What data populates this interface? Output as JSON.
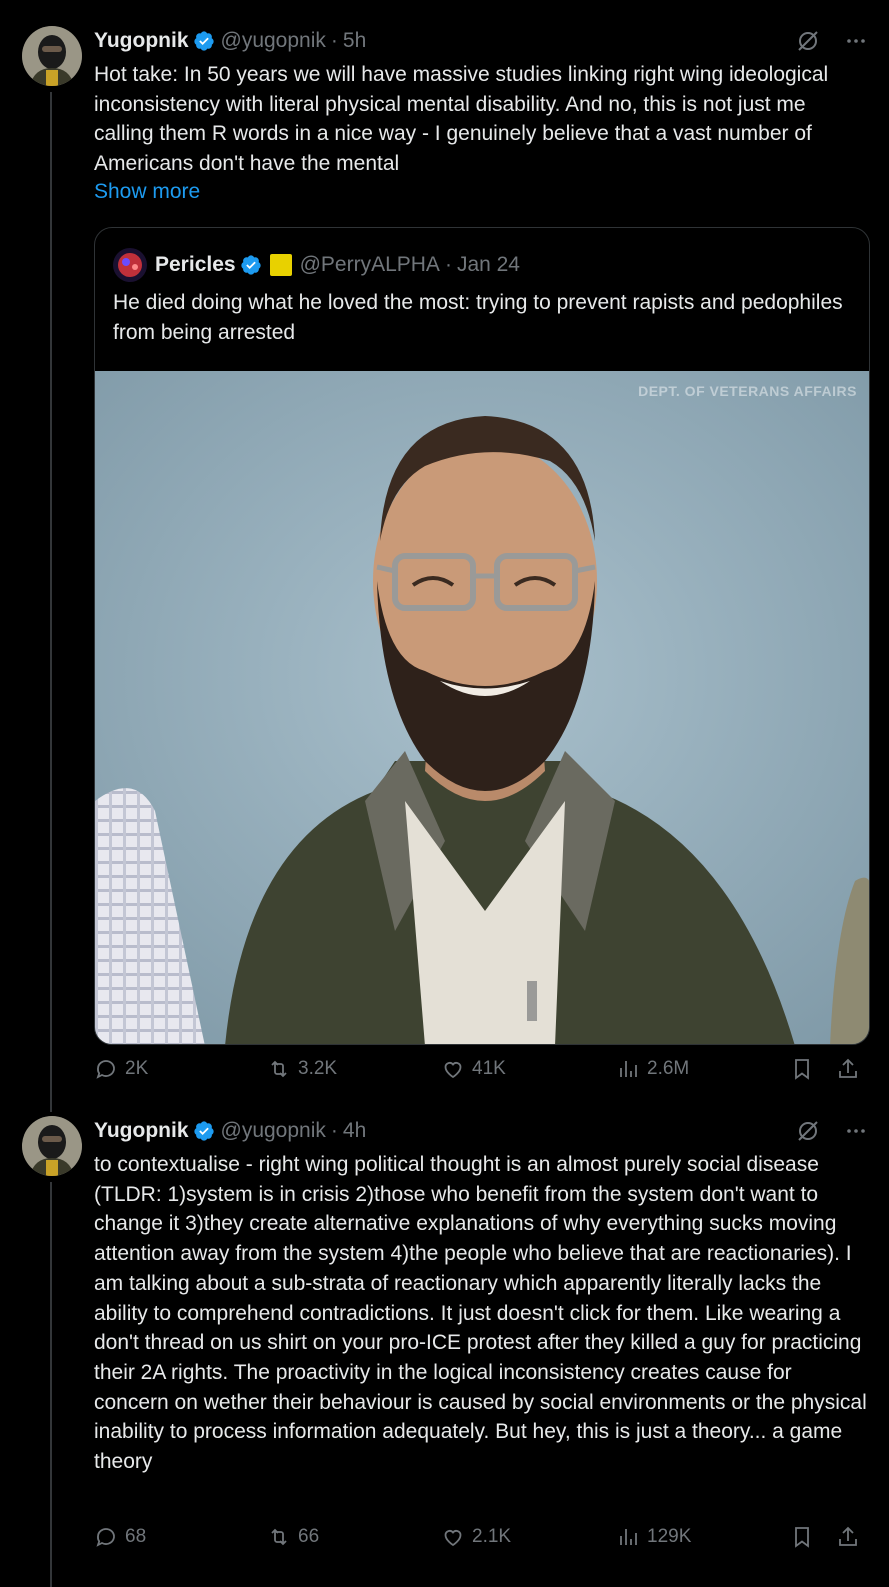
{
  "posts": [
    {
      "author_name": "Yugopnik",
      "handle": "@yugopnik",
      "separator": "·",
      "time": "5h",
      "text": "Hot take: In 50 years we will have massive studies linking right wing ideological inconsistency with literal physical mental disability. And no, this is not just me calling them R words in a nice way - I genuinely believe that a vast number of Americans don't have the mental",
      "show_more": "Show more",
      "quote": {
        "author_name": "Pericles",
        "handle": "@PerryALPHA",
        "separator": "·",
        "date": "Jan 24",
        "text": "He died doing what he loved the most: trying to prevent rapists and pedophiles from being arrested",
        "image_watermark": "DEPT. OF VETERANS AFFAIRS"
      },
      "stats": {
        "replies": "2K",
        "reposts": "3.2K",
        "likes": "41K",
        "views": "2.6M"
      }
    },
    {
      "author_name": "Yugopnik",
      "handle": "@yugopnik",
      "separator": "·",
      "time": "4h",
      "text": "to contextualise - right wing political thought is an almost purely social disease (TLDR: 1)system is in crisis 2)those who benefit from the system don't want to change it 3)they create alternative explanations of why everything sucks moving attention away from the system 4)the people who believe that are reactionaries). I am talking about a sub-strata of reactionary which apparently literally lacks the ability to comprehend contradictions. It just doesn't click for them. Like wearing a don't thread on us shirt on your pro-ICE protest after they killed a guy for practicing their 2A rights. The proactivity in the logical inconsistency creates cause for concern on wether their behaviour is caused by social environments or the physical inability to process information adequately. But hey, this is just a theory... a game theory",
      "stats": {
        "replies": "68",
        "reposts": "66",
        "likes": "2.1K",
        "views": "129K"
      }
    }
  ],
  "icons": {
    "verified": "verified-badge-icon",
    "grok": "grok-slash-icon",
    "more": "more-dots-icon",
    "reply": "reply-icon",
    "repost": "repost-icon",
    "like": "heart-icon",
    "views": "views-chart-icon",
    "bookmark": "bookmark-icon",
    "share": "share-icon"
  },
  "colors": {
    "background": "#000000",
    "text": "#e7e9ea",
    "muted": "#71767b",
    "accent": "#1d9bf0",
    "border": "#2f3336"
  }
}
